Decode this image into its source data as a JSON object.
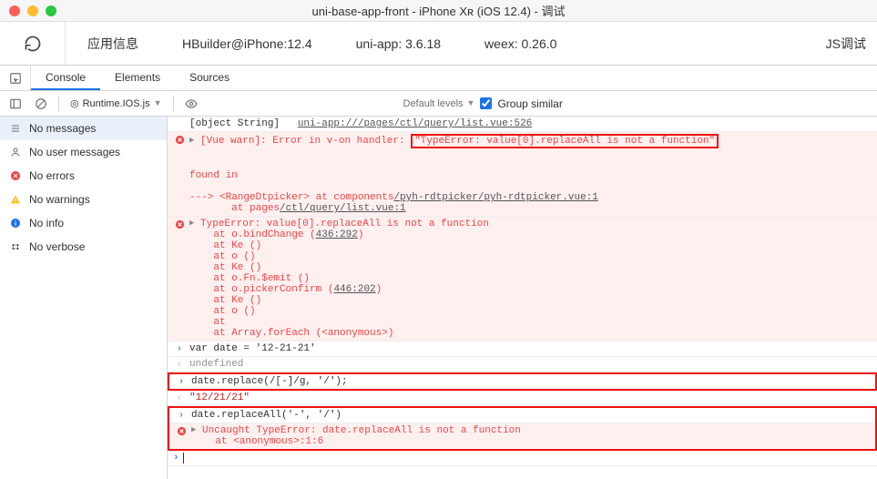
{
  "window": {
    "title": "uni-base-app-front - iPhone Xʀ (iOS 12.4) - 调试"
  },
  "info": {
    "app_info": "应用信息",
    "builder": "HBuilder@iPhone:12.4",
    "uniapp": "uni-app: 3.6.18",
    "weex": "weex: 0.26.0",
    "js_debug": "JS调试"
  },
  "tabs": {
    "console": "Console",
    "elements": "Elements",
    "sources": "Sources"
  },
  "toolbar": {
    "context_prefix": "◎",
    "context_label": "Runtime.IOS.js",
    "filter_placeholder": "",
    "levels_label": "Default levels",
    "group_similar": "Group similar"
  },
  "sidebar": {
    "items": [
      {
        "label": "No messages"
      },
      {
        "label": "No user messages"
      },
      {
        "label": "No errors"
      },
      {
        "label": "No warnings"
      },
      {
        "label": "No info"
      },
      {
        "label": "No verbose"
      }
    ]
  },
  "log": {
    "l0_obj": "[object String]   ",
    "l0_link": "uni-app:///pages/ctl/query/list.vue:526",
    "l1_a": "[Vue warn]: Error in v-on handler: ",
    "l1_b": "\"TypeError: value[0].replaceAll is not a function\"",
    "l2": "found in",
    "l3_a": "---> <RangeDtpicker> at components",
    "l3_link": "/pyh-rdtpicker/pyh-rdtpicker.vue:1",
    "l4_a": "       at pages",
    "l4_link": "/ctl/query/list.vue:1",
    "l5": "TypeError: value[0].replaceAll is not a function",
    "l6_a": "    at o.bindChange (",
    "l6_link": "436:292",
    "l6_b": ")",
    "l7": "    at Ke ()",
    "l8": "    at o ()",
    "l9": "    at Ke ()",
    "l10": "    at o.Fn.$emit ()",
    "l11_a": "    at o.pickerConfirm (",
    "l11_link": "446:202",
    "l11_b": ")",
    "l12": "    at Ke ()",
    "l13": "    at o ()",
    "l14": "    at",
    "l15": "    at Array.forEach (<anonymous>)",
    "l16": "var date = '12-21-21'",
    "l17": "undefined",
    "l18": "date.replace(/[-]/g, '/');",
    "l19": "\"12/21/21\"",
    "l20": "date.replaceAll('-', '/')",
    "l21": "Uncaught TypeError: date.replaceAll is not a function\n    at <anonymous>:1:6"
  }
}
